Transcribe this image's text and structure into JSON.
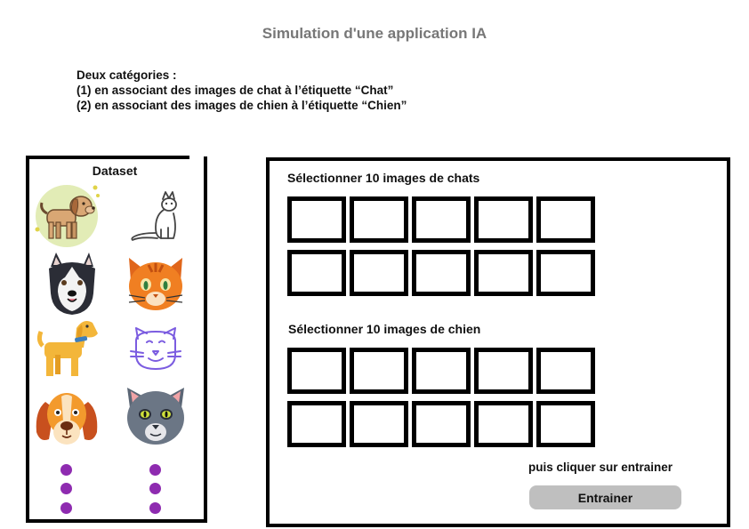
{
  "title": "Simulation d'une application IA",
  "intro": {
    "line1": "Deux catégories :",
    "line2": "(1) en associant des images de chat à l’étiquette “Chat”",
    "line3": "(2) en associant des images de chien à l’étiquette “Chien”"
  },
  "dataset": {
    "title": "Dataset",
    "images": [
      {
        "animal": "chien",
        "icon": "dog-icon"
      },
      {
        "animal": "chat",
        "icon": "cat-outline-icon"
      },
      {
        "animal": "chien",
        "icon": "husky-icon"
      },
      {
        "animal": "chat",
        "icon": "orange-cat-icon"
      },
      {
        "animal": "chien",
        "icon": "yellow-dog-icon"
      },
      {
        "animal": "chat",
        "icon": "purple-cat-icon"
      },
      {
        "animal": "chien",
        "icon": "beagle-icon"
      },
      {
        "animal": "chat",
        "icon": "grey-cat-icon"
      }
    ],
    "more_indicator_color": "#8e2bb0"
  },
  "selection": {
    "cats_label": "Sélectionner 10 images de chats",
    "dogs_label": "Sélectionner 10 images de chien",
    "slots_per_group": 10,
    "hint": "puis cliquer sur entrainer",
    "train_button": "Entrainer"
  },
  "colors": {
    "title": "#777777",
    "button": "#bfbfbf",
    "dots": "#8e2bb0"
  }
}
